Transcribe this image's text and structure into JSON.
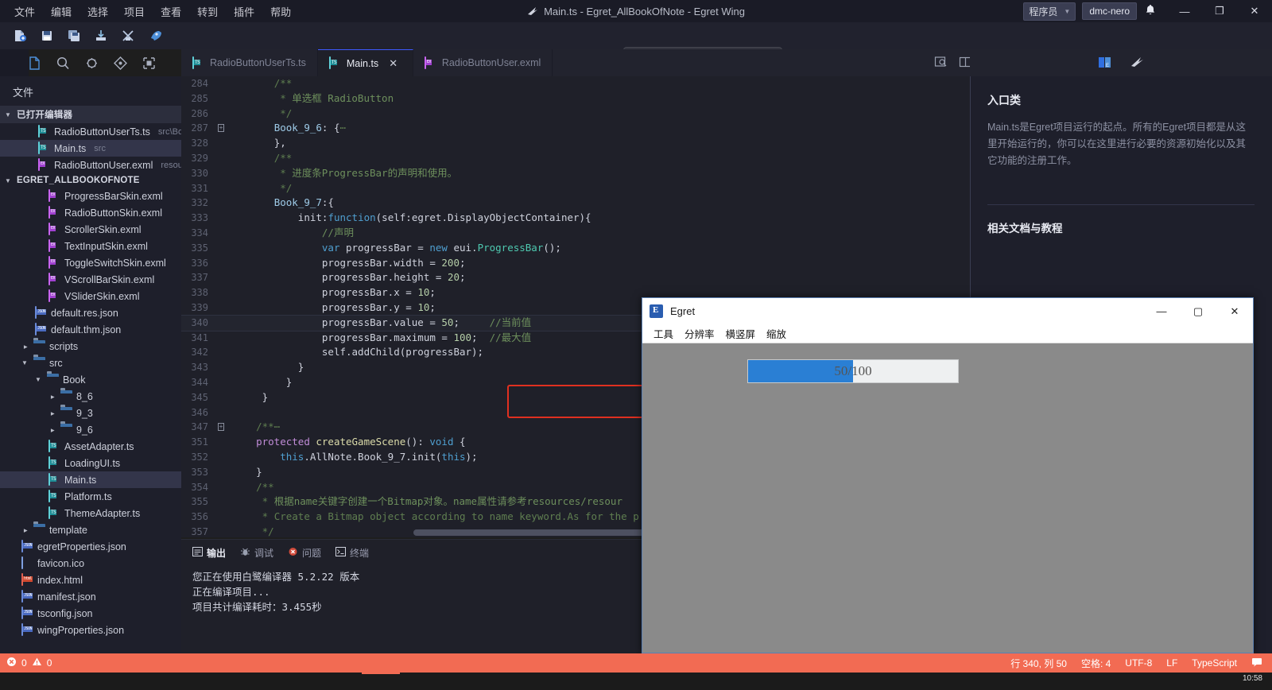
{
  "titlebar": {
    "menus": [
      "文件",
      "编辑",
      "选择",
      "项目",
      "查看",
      "转到",
      "插件",
      "帮助"
    ],
    "title": "Main.ts - Egret_AllBookOfNote - Egret Wing",
    "user_role": "程序员",
    "user_name": "dmc-nero",
    "bell_icon": "bell-icon",
    "minimize": "—",
    "maximize": "❐",
    "close": "✕"
  },
  "toolbar": {
    "buttons": [
      "new-file-icon",
      "save-icon",
      "save-all-icon",
      "import-icon",
      "build-icon",
      "run-icon"
    ],
    "debug_buttons": [
      "drag-handle-icon",
      "pause-icon",
      "step-over-icon",
      "step-into-icon",
      "step-out-icon",
      "restart-icon",
      "stop-icon"
    ],
    "layout_buttons": [
      "toggle-sidebar-icon",
      "toggle-panel-icon",
      "toggle-rightbar-icon"
    ]
  },
  "activitybar": {
    "items": [
      "explorer-icon",
      "search-icon",
      "debug-icon",
      "source-control-icon",
      "extensions-icon"
    ]
  },
  "sidebar": {
    "title": "文件",
    "open_editors": {
      "label": "已打开编辑器",
      "items": [
        {
          "name": "RadioButtonUserTs.ts",
          "sub": "src\\Boo...",
          "icon": "ts-file-icon",
          "selected": false
        },
        {
          "name": "Main.ts",
          "sub": "src",
          "icon": "ts-file-icon",
          "selected": true
        },
        {
          "name": "RadioButtonUser.exml",
          "sub": "resour...",
          "icon": "exml-file-icon",
          "selected": false
        }
      ]
    },
    "project": {
      "label": "EGRET_ALLBOOKOFNOTE",
      "items": [
        {
          "name": "ProgressBarSkin.exml",
          "icon": "exml-file-icon",
          "indent": 3,
          "type": "file"
        },
        {
          "name": "RadioButtonSkin.exml",
          "icon": "exml-file-icon",
          "indent": 3,
          "type": "file"
        },
        {
          "name": "ScrollerSkin.exml",
          "icon": "exml-file-icon",
          "indent": 3,
          "type": "file"
        },
        {
          "name": "TextInputSkin.exml",
          "icon": "exml-file-icon",
          "indent": 3,
          "type": "file"
        },
        {
          "name": "ToggleSwitchSkin.exml",
          "icon": "exml-file-icon",
          "indent": 3,
          "type": "file"
        },
        {
          "name": "VScrollBarSkin.exml",
          "icon": "exml-file-icon",
          "indent": 3,
          "type": "file"
        },
        {
          "name": "VSliderSkin.exml",
          "icon": "exml-file-icon",
          "indent": 3,
          "type": "file"
        },
        {
          "name": "default.res.json",
          "icon": "json-file-icon",
          "indent": 2,
          "type": "file"
        },
        {
          "name": "default.thm.json",
          "icon": "json-file-icon",
          "indent": 2,
          "type": "file"
        },
        {
          "name": "scripts",
          "icon": "folder-icon",
          "indent": 1,
          "type": "folder",
          "expanded": false
        },
        {
          "name": "src",
          "icon": "folder-open-icon",
          "indent": 1,
          "type": "folder",
          "expanded": true
        },
        {
          "name": "Book",
          "icon": "folder-open-icon",
          "indent": 2,
          "type": "folder",
          "expanded": true
        },
        {
          "name": "8_6",
          "icon": "folder-icon",
          "indent": 3,
          "type": "folder",
          "expanded": false
        },
        {
          "name": "9_3",
          "icon": "folder-icon",
          "indent": 3,
          "type": "folder",
          "expanded": false
        },
        {
          "name": "9_6",
          "icon": "folder-icon",
          "indent": 3,
          "type": "folder",
          "expanded": false
        },
        {
          "name": "AssetAdapter.ts",
          "icon": "ts-file-icon",
          "indent": 3,
          "type": "file"
        },
        {
          "name": "LoadingUI.ts",
          "icon": "ts-file-icon",
          "indent": 3,
          "type": "file"
        },
        {
          "name": "Main.ts",
          "icon": "ts-file-icon",
          "indent": 3,
          "type": "file",
          "selected": true
        },
        {
          "name": "Platform.ts",
          "icon": "ts-file-icon",
          "indent": 3,
          "type": "file"
        },
        {
          "name": "ThemeAdapter.ts",
          "icon": "ts-file-icon",
          "indent": 3,
          "type": "file"
        },
        {
          "name": "template",
          "icon": "folder-icon",
          "indent": 1,
          "type": "folder",
          "expanded": false
        },
        {
          "name": "egretProperties.json",
          "icon": "json-file-icon",
          "indent": 1,
          "type": "file"
        },
        {
          "name": "favicon.ico",
          "icon": "ico-file-icon",
          "indent": 1,
          "type": "file"
        },
        {
          "name": "index.html",
          "icon": "html-file-icon",
          "indent": 1,
          "type": "file"
        },
        {
          "name": "manifest.json",
          "icon": "json-file-icon",
          "indent": 1,
          "type": "file"
        },
        {
          "name": "tsconfig.json",
          "icon": "json-file-icon",
          "indent": 1,
          "type": "file"
        },
        {
          "name": "wingProperties.json",
          "icon": "json-file-icon",
          "indent": 1,
          "type": "file"
        }
      ]
    }
  },
  "editor": {
    "tabs": [
      {
        "label": "RadioButtonUserTs.ts",
        "icon": "ts-file-icon",
        "active": false,
        "closable": false
      },
      {
        "label": "Main.ts",
        "icon": "ts-file-icon",
        "active": true,
        "closable": true
      },
      {
        "label": "RadioButtonUser.exml",
        "icon": "exml-file-icon",
        "active": false,
        "closable": false
      }
    ],
    "tab_actions": [
      "split-preview-icon",
      "split-editor-icon",
      "more-actions-icon"
    ],
    "close_glyph": "✕",
    "lines": [
      {
        "num": "284",
        "fold": "",
        "indent": 7,
        "parts": [
          [
            "cmt",
            "/**"
          ]
        ]
      },
      {
        "num": "285",
        "fold": "",
        "indent": 8,
        "parts": [
          [
            "cmt",
            "* "
          ],
          [
            "cmt-cn",
            "单选框 RadioButton"
          ]
        ]
      },
      {
        "num": "286",
        "fold": "",
        "indent": 8,
        "parts": [
          [
            "cmt",
            "*/"
          ]
        ]
      },
      {
        "num": "287",
        "fold": "+",
        "indent": 7,
        "parts": [
          [
            "id",
            "Book_9_6"
          ],
          [
            "plain",
            ": {"
          ],
          [
            "cmt",
            "⋯"
          ]
        ]
      },
      {
        "num": "328",
        "fold": "",
        "indent": 7,
        "parts": [
          [
            "plain",
            "},"
          ]
        ]
      },
      {
        "num": "329",
        "fold": "",
        "indent": 7,
        "parts": [
          [
            "cmt",
            "/**"
          ]
        ]
      },
      {
        "num": "330",
        "fold": "",
        "indent": 8,
        "parts": [
          [
            "cmt",
            "* "
          ],
          [
            "cmt-cn",
            "进度条ProgressBar的声明和使用。"
          ]
        ]
      },
      {
        "num": "331",
        "fold": "",
        "indent": 8,
        "parts": [
          [
            "cmt",
            "*/"
          ]
        ]
      },
      {
        "num": "332",
        "fold": "",
        "indent": 7,
        "parts": [
          [
            "id",
            "Book_9_7"
          ],
          [
            "plain",
            ":{"
          ]
        ]
      },
      {
        "num": "333",
        "fold": "",
        "indent": 11,
        "parts": [
          [
            "plain",
            "init:"
          ],
          [
            "kw",
            "function"
          ],
          [
            "plain",
            "(self:"
          ],
          [
            "plain",
            "egret.DisplayObjectContainer){"
          ]
        ]
      },
      {
        "num": "334",
        "fold": "",
        "indent": 15,
        "parts": [
          [
            "cmt-cn",
            "//声明"
          ]
        ]
      },
      {
        "num": "335",
        "fold": "",
        "indent": 15,
        "parts": [
          [
            "kw",
            "var"
          ],
          [
            "plain",
            " progressBar = "
          ],
          [
            "kw",
            "new"
          ],
          [
            "plain",
            " eui."
          ],
          [
            "type",
            "ProgressBar"
          ],
          [
            "plain",
            "();"
          ]
        ]
      },
      {
        "num": "336",
        "fold": "",
        "indent": 15,
        "parts": [
          [
            "plain",
            "progressBar.width = "
          ],
          [
            "num-lit",
            "200"
          ],
          [
            "plain",
            ";"
          ]
        ]
      },
      {
        "num": "337",
        "fold": "",
        "indent": 15,
        "parts": [
          [
            "plain",
            "progressBar.height = "
          ],
          [
            "num-lit",
            "20"
          ],
          [
            "plain",
            ";"
          ]
        ]
      },
      {
        "num": "338",
        "fold": "",
        "indent": 15,
        "parts": [
          [
            "plain",
            "progressBar.x = "
          ],
          [
            "num-lit",
            "10"
          ],
          [
            "plain",
            ";"
          ]
        ]
      },
      {
        "num": "339",
        "fold": "",
        "indent": 15,
        "parts": [
          [
            "plain",
            "progressBar.y = "
          ],
          [
            "num-lit",
            "10"
          ],
          [
            "plain",
            ";"
          ]
        ]
      },
      {
        "num": "340",
        "fold": "",
        "indent": 15,
        "current": true,
        "parts": [
          [
            "plain",
            "progressBar.value = "
          ],
          [
            "num-lit",
            "50"
          ],
          [
            "plain",
            ";     "
          ],
          [
            "cmt-cn",
            "//当前值"
          ]
        ]
      },
      {
        "num": "341",
        "fold": "",
        "indent": 15,
        "parts": [
          [
            "plain",
            "progressBar.maximum = "
          ],
          [
            "num-lit",
            "100"
          ],
          [
            "plain",
            ";  "
          ],
          [
            "cmt-cn",
            "//最大值"
          ]
        ]
      },
      {
        "num": "342",
        "fold": "",
        "indent": 15,
        "parts": [
          [
            "plain",
            "self.addChild(progressBar);"
          ]
        ]
      },
      {
        "num": "343",
        "fold": "",
        "indent": 11,
        "parts": [
          [
            "plain",
            "}"
          ]
        ]
      },
      {
        "num": "344",
        "fold": "",
        "indent": 9,
        "parts": [
          [
            "plain",
            "}"
          ]
        ]
      },
      {
        "num": "345",
        "fold": "",
        "indent": 5,
        "parts": [
          [
            "plain",
            "}"
          ]
        ]
      },
      {
        "num": "346",
        "fold": "",
        "indent": 0,
        "parts": [
          [
            "plain",
            ""
          ]
        ]
      },
      {
        "num": "347",
        "fold": "+",
        "indent": 4,
        "parts": [
          [
            "cmt",
            "/**⋯"
          ]
        ]
      },
      {
        "num": "351",
        "fold": "",
        "indent": 4,
        "parts": [
          [
            "kw2",
            "protected"
          ],
          [
            "plain",
            " "
          ],
          [
            "fn",
            "createGameScene"
          ],
          [
            "plain",
            "(): "
          ],
          [
            "kw",
            "void"
          ],
          [
            "plain",
            " {"
          ]
        ]
      },
      {
        "num": "352",
        "fold": "",
        "indent": 8,
        "parts": [
          [
            "kw",
            "this"
          ],
          [
            "plain",
            ".AllNote.Book_9_7.init("
          ],
          [
            "kw",
            "this"
          ],
          [
            "plain",
            ");"
          ]
        ]
      },
      {
        "num": "353",
        "fold": "",
        "indent": 4,
        "parts": [
          [
            "plain",
            "}"
          ]
        ]
      },
      {
        "num": "354",
        "fold": "",
        "indent": 4,
        "parts": [
          [
            "cmt",
            "/**"
          ]
        ]
      },
      {
        "num": "355",
        "fold": "",
        "indent": 5,
        "parts": [
          [
            "cmt",
            "* "
          ],
          [
            "cmt-cn",
            "根据name关键字创建一个Bitmap对象。name属性请参考resources/resour"
          ]
        ]
      },
      {
        "num": "356",
        "fold": "",
        "indent": 5,
        "parts": [
          [
            "cmt",
            "* Create a Bitmap object according to name keyword.As for the p"
          ]
        ]
      },
      {
        "num": "357",
        "fold": "",
        "indent": 5,
        "parts": [
          [
            "cmt",
            "*/"
          ]
        ]
      }
    ]
  },
  "panel": {
    "tabs": [
      {
        "label": "输出",
        "icon": "output-icon",
        "active": true
      },
      {
        "label": "调试",
        "icon": "debug-icon",
        "active": false
      },
      {
        "label": "问题",
        "icon": "problems-icon",
        "active": false
      },
      {
        "label": "终端",
        "icon": "terminal-icon",
        "active": false
      }
    ],
    "output_lines": [
      "您正在使用白鹭编译器 5.2.22 版本",
      "正在编译项目...",
      "项目共计编译耗时：3.455秒"
    ]
  },
  "rightpanel": {
    "tabs": [
      "docs-icon",
      "wing-icon"
    ],
    "heading": "入口类",
    "paragraph": "Main.ts是Egret项目运行的起点。所有的Egret项目都是从这里开始运行的，你可以在这里进行必要的资源初始化以及其它功能的注册工作。",
    "heading2": "相关文档与教程"
  },
  "egret_window": {
    "title": "Egret",
    "icon": "egret-app-icon",
    "menus": [
      "工具",
      "分辨率",
      "横竖屏",
      "缩放"
    ],
    "minimize": "—",
    "maximize": "▢",
    "close": "✕",
    "progressbar": {
      "value": 50,
      "maximum": 100,
      "label": "50/100",
      "fill_percent": 50,
      "fill_color": "#2a7fd4",
      "track_color": "#eef0f1"
    }
  },
  "statusbar": {
    "errors_icon": "error-icon",
    "errors": "0",
    "warnings_icon": "warning-icon",
    "warnings": "0",
    "line_col": "行 340, 列 50",
    "spaces": "空格: 4",
    "encoding": "UTF-8",
    "eol": "LF",
    "language": "TypeScript",
    "feedback_icon": "feedback-icon",
    "bg_color": "#f26b53"
  },
  "taskbar": {
    "clock": "10:58"
  }
}
